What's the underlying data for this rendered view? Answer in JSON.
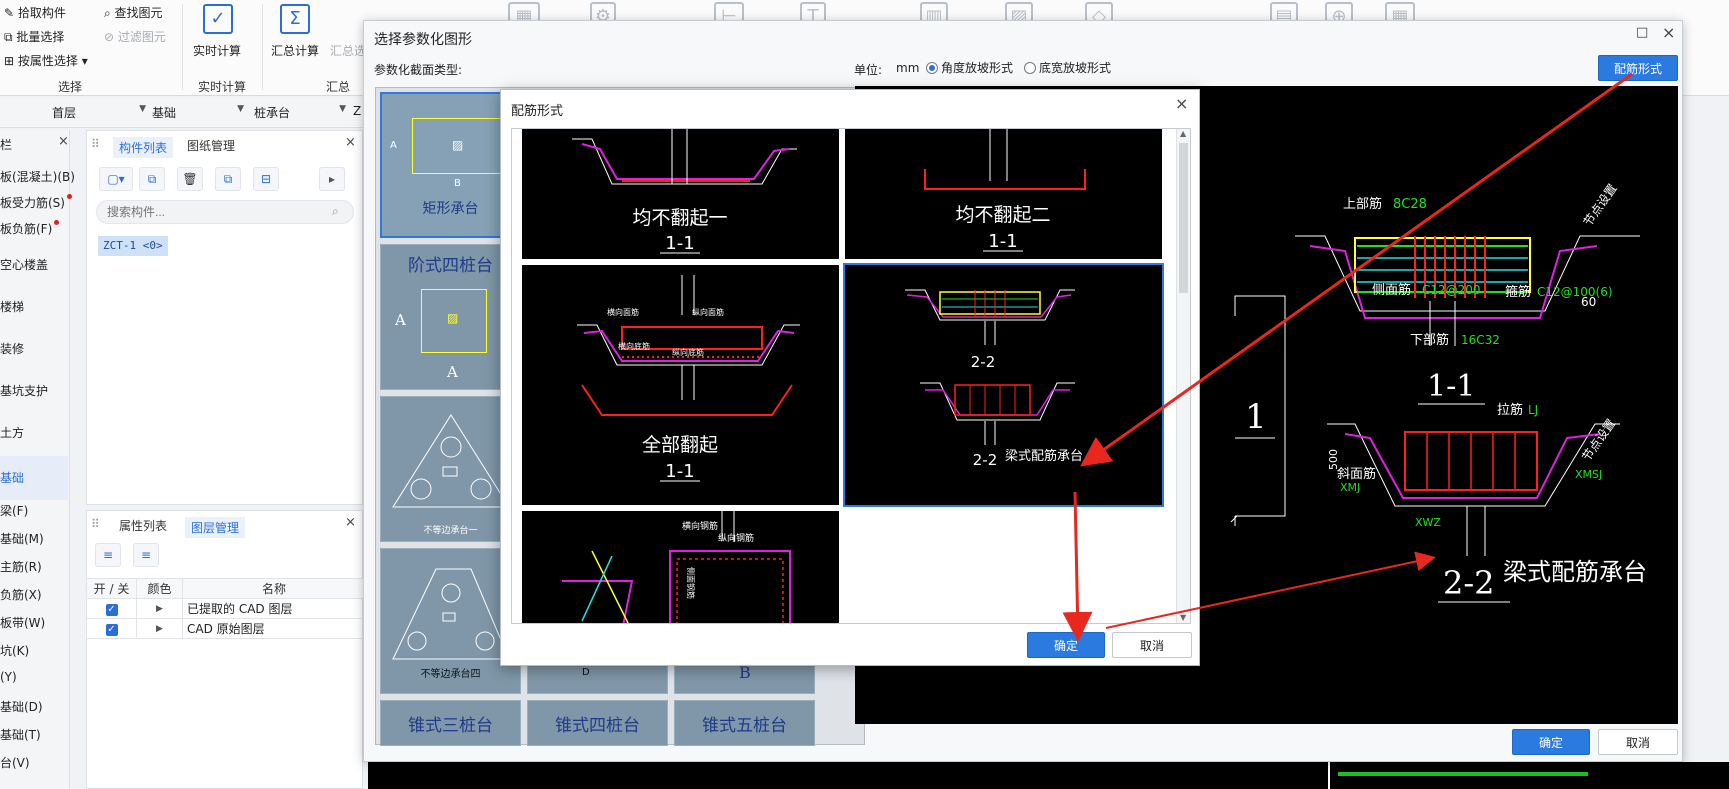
{
  "toolbar": {
    "pick_component": "拾取构件",
    "batch_select": "批量选择",
    "select_by_attribute": "按属性选择",
    "find_element": "查找图元",
    "filter_element": "过滤图元",
    "group_select": "选择",
    "realtime_calc": "实时计算",
    "group_realtime_calc": "实时计算",
    "summary_calc": "汇总计算",
    "summary_calc_dim": "汇总选",
    "group_summary": "汇总"
  },
  "combos": {
    "floor": "首层",
    "category": "基础",
    "type": "桩承台",
    "extra": "Z"
  },
  "leftnav": {
    "title": "栏",
    "items": [
      {
        "label": "板(混凝土)(B)"
      },
      {
        "label": "板受力筋(S)",
        "dot": true
      },
      {
        "label": "板负筋(F)",
        "dot": true
      },
      {
        "label": "空心楼盖"
      },
      {
        "label": "楼梯"
      },
      {
        "label": "装修"
      },
      {
        "label": "基坑支护"
      },
      {
        "label": "土方"
      },
      {
        "label": "基础"
      },
      {
        "label": "梁(F)"
      },
      {
        "label": "基础(M)"
      },
      {
        "label": "主筋(R)"
      },
      {
        "label": "负筋(X)"
      },
      {
        "label": "板带(W)"
      },
      {
        "label": "坑(K)"
      },
      {
        "label": "(Y)"
      },
      {
        "label": "基础(D)"
      },
      {
        "label": "基础(T)"
      },
      {
        "label": "台(V)"
      }
    ]
  },
  "component_panel": {
    "tab_components": "构件列表",
    "tab_drawings": "图纸管理",
    "search_placeholder": "搜索构件...",
    "item": "ZCT-1 <0>"
  },
  "layer_panel": {
    "tab_properties": "属性列表",
    "tab_layers": "图层管理",
    "col_onoff": "开 / 关",
    "col_color": "颜色",
    "col_name": "名称",
    "rows": [
      {
        "name": "已提取的 CAD 图层"
      },
      {
        "name": "CAD 原始图层"
      }
    ]
  },
  "param_dialog": {
    "title": "选择参数化图形",
    "section_type_label": "参数化截面类型:",
    "unit_label": "单位:",
    "unit_value": "mm",
    "radio_angle": "角度放坡形式",
    "radio_width": "底宽放坡形式",
    "rebar_form_button": "配筋形式",
    "ok": "确定",
    "cancel": "取消",
    "thumbs": [
      "矩形承台",
      "阶式四桩台",
      "不等边承台一",
      "不等边承台四"
    ],
    "thumb_dim_a": "A",
    "thumb_dim_b": "B",
    "thumb_dim_d": "D",
    "thumb_bottom_row": [
      "锥式三桩台",
      "锥式四桩台",
      "锥式五桩台"
    ],
    "preview": {
      "top_rebar": "上部筋",
      "top_rebar_val": "8C28",
      "side_rebar": "侧面筋",
      "side_rebar_val": "C12@200",
      "stirrup": "箍筋",
      "stirrup_val": "C12@100(6)",
      "bottom_rebar": "下部筋",
      "bottom_rebar_val": "16C32",
      "node_setting": "节点设置",
      "section_1": "1-1",
      "tie_bar": "拉筋",
      "tie_bar_val": "LJ",
      "slope_rebar": "斜面筋",
      "slope_rebar_val": "XMJ",
      "xmsj": "XMSJ",
      "xwz": "XWZ",
      "dim_500": "500",
      "section_2": "2-2",
      "beam_cap": "梁式配筋承台",
      "big_one": "1",
      "angle_60": "60"
    }
  },
  "rebar_dialog": {
    "title": "配筋形式",
    "cells": [
      {
        "name": "均不翻起一",
        "section": "1-1"
      },
      {
        "name": "均不翻起二",
        "section": "1-1"
      },
      {
        "name": "全部翻起",
        "section": "1-1"
      },
      {
        "name": "梁式配筋承台",
        "section": "2-2"
      },
      {
        "name": "",
        "section": ""
      }
    ],
    "labels": {
      "heng_mian": "横向面筋",
      "zong_mian": "纵向面筋",
      "heng_di": "横向底筋",
      "zong_di": "纵向底筋",
      "heng_gang": "横向钢筋",
      "zong_gang": "纵向钢筋",
      "ce_mian": "侧面钢筋"
    },
    "ok": "确定",
    "cancel": "取消"
  },
  "colors": {
    "accent": "#2b7ae0",
    "cad_white": "#ffffff",
    "cad_red": "#ff1f1f",
    "cad_magenta": "#e020e0",
    "cad_green": "#20e020",
    "cad_yellow": "#ffff30",
    "cad_cyan": "#20e0e0",
    "arrow_red": "#e8271f"
  }
}
